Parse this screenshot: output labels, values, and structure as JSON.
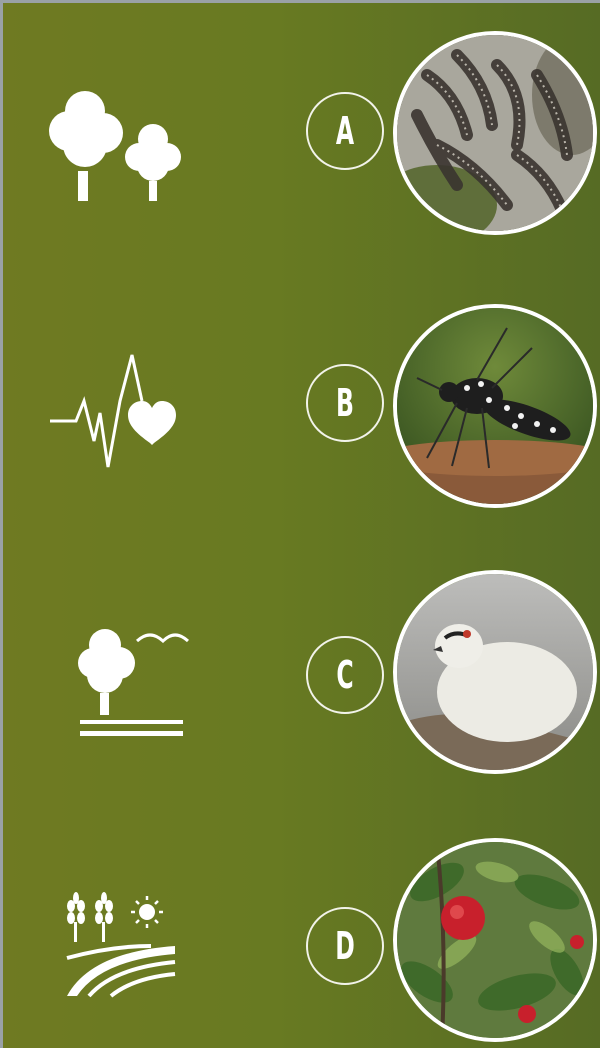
{
  "rows": [
    {
      "letter": "A",
      "icon": "forest-trees-icon",
      "photo": "caterpillar-nest-photo"
    },
    {
      "letter": "B",
      "icon": "heartbeat-heart-icon",
      "photo": "mosquito-photo"
    },
    {
      "letter": "C",
      "icon": "tree-bird-landscape-icon",
      "photo": "white-ptarmigan-bird-photo"
    },
    {
      "letter": "D",
      "icon": "agriculture-field-sun-icon",
      "photo": "pomegranate-tree-photo"
    }
  ],
  "colors": {
    "panel_left": "#6f7a22",
    "panel_right": "#566b24",
    "icon": "#ffffff",
    "frame": "#9aa1a6"
  }
}
